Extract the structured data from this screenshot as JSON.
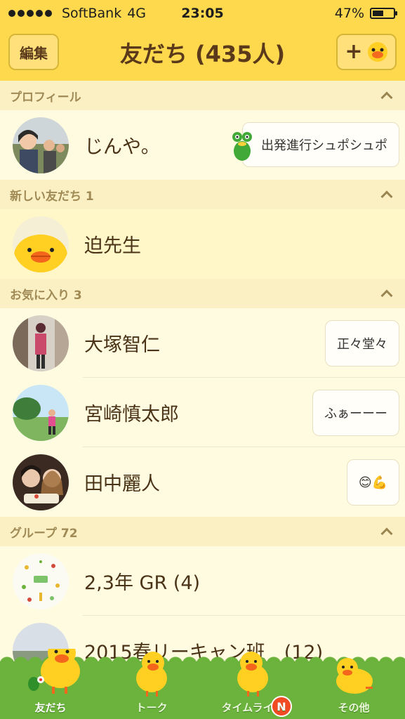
{
  "status": {
    "carrier": "SoftBank",
    "network": "4G",
    "time": "23:05",
    "battery": "47%"
  },
  "header": {
    "edit_label": "編集",
    "title": "友だち (435人)"
  },
  "sections": {
    "profile": {
      "title": "プロフィール"
    },
    "new_friends": {
      "title": "新しい友だち 1"
    },
    "favorites": {
      "title": "お気に入り 3"
    },
    "groups": {
      "title": "グループ 72"
    }
  },
  "rows": {
    "profile": {
      "name": "じんや。",
      "status": "出発進行シュポシュポ"
    },
    "new_friend": {
      "name": "迫先生"
    },
    "fav1": {
      "name": "大塚智仁",
      "status": "正々堂々"
    },
    "fav2": {
      "name": "宮崎慎太郎",
      "status": "ふぁーーー"
    },
    "fav3": {
      "name": "田中麗人",
      "status": "😊💪"
    },
    "group1": {
      "name": "2,3年 GR (4)"
    },
    "group2_partial": {
      "name": "2015春リーキャン班　(12)"
    }
  },
  "tabs": [
    {
      "label": "友だち"
    },
    {
      "label": "トーク"
    },
    {
      "label": "タイムライン",
      "badge": "N"
    },
    {
      "label": "その他"
    }
  ],
  "colors": {
    "header_bg": "#ffd94d",
    "list_bg": "#fffbe0",
    "section_bg": "#fbf0c4",
    "tab_grass": "#6bb33c",
    "badge": "#f04b23"
  }
}
